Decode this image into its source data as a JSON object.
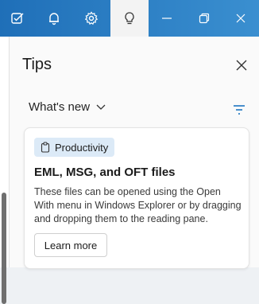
{
  "colors": {
    "topbar": "#1f6fb8",
    "chip_bg": "#dceaf7",
    "accent": "#0f6cbd"
  },
  "icons": {
    "todo": "todo-icon",
    "bell": "bell-icon",
    "settings": "gear-icon",
    "tips": "lightbulb-icon",
    "minimize": "minimize-icon",
    "restore": "restore-icon",
    "close_window": "close-icon"
  },
  "pane": {
    "title": "Tips",
    "filter_label": "What's new",
    "card": {
      "tag": "Productivity",
      "title": "EML, MSG, and OFT files",
      "body": "These files can be opened using the Open With menu in Windows Explorer or by dragging and dropping them to the reading pane.",
      "button": "Learn more"
    }
  }
}
